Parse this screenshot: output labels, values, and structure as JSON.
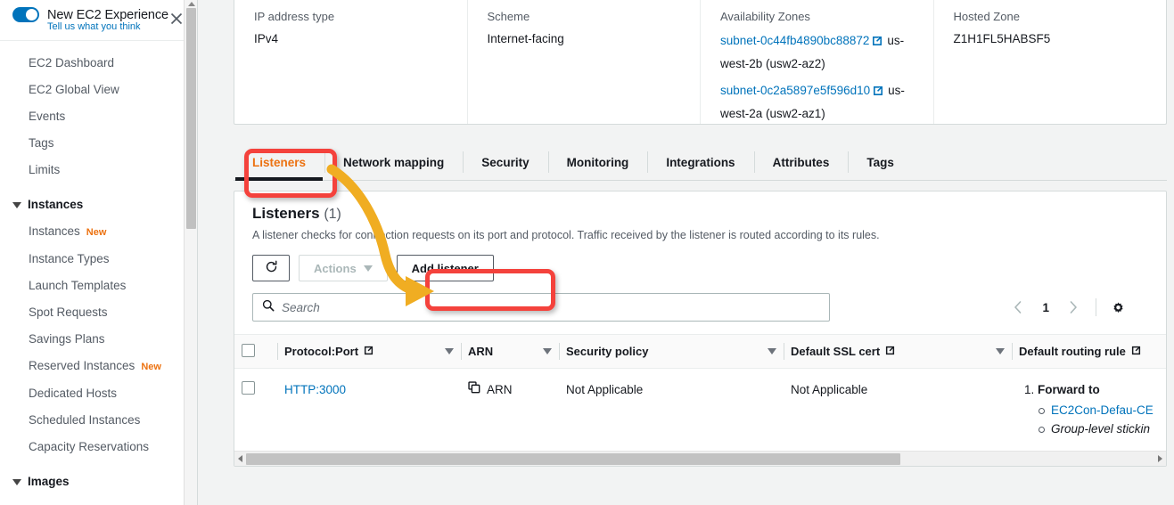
{
  "sidebar": {
    "experience_toggle_label": "New EC2 Experience",
    "feedback_link": "Tell us what you think",
    "close_icon": "close-icon",
    "toggle_on": true,
    "items": [
      {
        "label": "EC2 Dashboard",
        "type": "link"
      },
      {
        "label": "EC2 Global View",
        "type": "link"
      },
      {
        "label": "Events",
        "type": "link"
      },
      {
        "label": "Tags",
        "type": "link"
      },
      {
        "label": "Limits",
        "type": "link"
      }
    ],
    "group_instances": "Instances",
    "instance_items": [
      {
        "label": "Instances",
        "badge": "New"
      },
      {
        "label": "Instance Types",
        "badge": ""
      },
      {
        "label": "Launch Templates",
        "badge": ""
      },
      {
        "label": "Spot Requests",
        "badge": ""
      },
      {
        "label": "Savings Plans",
        "badge": ""
      },
      {
        "label": "Reserved Instances",
        "badge": "New"
      },
      {
        "label": "Dedicated Hosts",
        "badge": ""
      },
      {
        "label": "Scheduled Instances",
        "badge": ""
      },
      {
        "label": "Capacity Reservations",
        "badge": ""
      }
    ],
    "group_images": "Images"
  },
  "detail_panel": {
    "columns": [
      {
        "label": "IP address type",
        "value": "IPv4"
      },
      {
        "label": "Scheme",
        "value": "Internet-facing"
      }
    ],
    "az": {
      "label": "Availability Zones",
      "entries": [
        {
          "subnet": "subnet-0c44fb4890bc88872",
          "zone": "us-west-2b (usw2-az2)"
        },
        {
          "subnet": "subnet-0c2a5897e5f596d10",
          "zone": "us-west-2a (usw2-az1)"
        }
      ]
    },
    "hosted_zone": {
      "label": "Hosted Zone",
      "value": "Z1H1FL5HABSF5"
    }
  },
  "tabs": [
    {
      "label": "Listeners",
      "active": true
    },
    {
      "label": "Network mapping",
      "active": false
    },
    {
      "label": "Security",
      "active": false
    },
    {
      "label": "Monitoring",
      "active": false
    },
    {
      "label": "Integrations",
      "active": false
    },
    {
      "label": "Attributes",
      "active": false
    },
    {
      "label": "Tags",
      "active": false
    }
  ],
  "listeners_card": {
    "title": "Listeners",
    "count": "(1)",
    "description": "A listener checks for connection requests on its port and protocol. Traffic received by the listener is routed according to its rules.",
    "refresh_icon": "refresh-icon",
    "actions_label": "Actions",
    "actions_disabled": true,
    "add_listener_label": "Add listener",
    "search_placeholder": "Search",
    "search_value": "",
    "search_icon": "search-icon",
    "pagination": {
      "prev": "‹",
      "page": "1",
      "next": "›",
      "settings_icon": "gear-icon"
    },
    "columns": [
      {
        "label": "Protocol:Port",
        "external": true,
        "sortable": true
      },
      {
        "label": "ARN",
        "external": false,
        "sortable": true
      },
      {
        "label": "Security policy",
        "external": false,
        "sortable": true
      },
      {
        "label": "Default SSL cert",
        "external": true,
        "sortable": true
      },
      {
        "label": "Default routing rule",
        "external": true,
        "sortable": false
      }
    ],
    "rows": [
      {
        "selected": false,
        "protocol_port": "HTTP:3000",
        "arn": "ARN",
        "arn_icon": "copy-icon",
        "security_policy": "Not Applicable",
        "default_ssl_cert": "Not Applicable",
        "routing_number": "1.",
        "routing_action": "Forward to",
        "routing_target": "EC2Con-Defau-CE",
        "routing_note": "Group-level stickin"
      }
    ]
  },
  "annotations": {
    "highlight_tab": "Listeners",
    "highlight_button": "Add listener",
    "box_color": "#f4423c",
    "arrow_color": "#f0ad22"
  }
}
